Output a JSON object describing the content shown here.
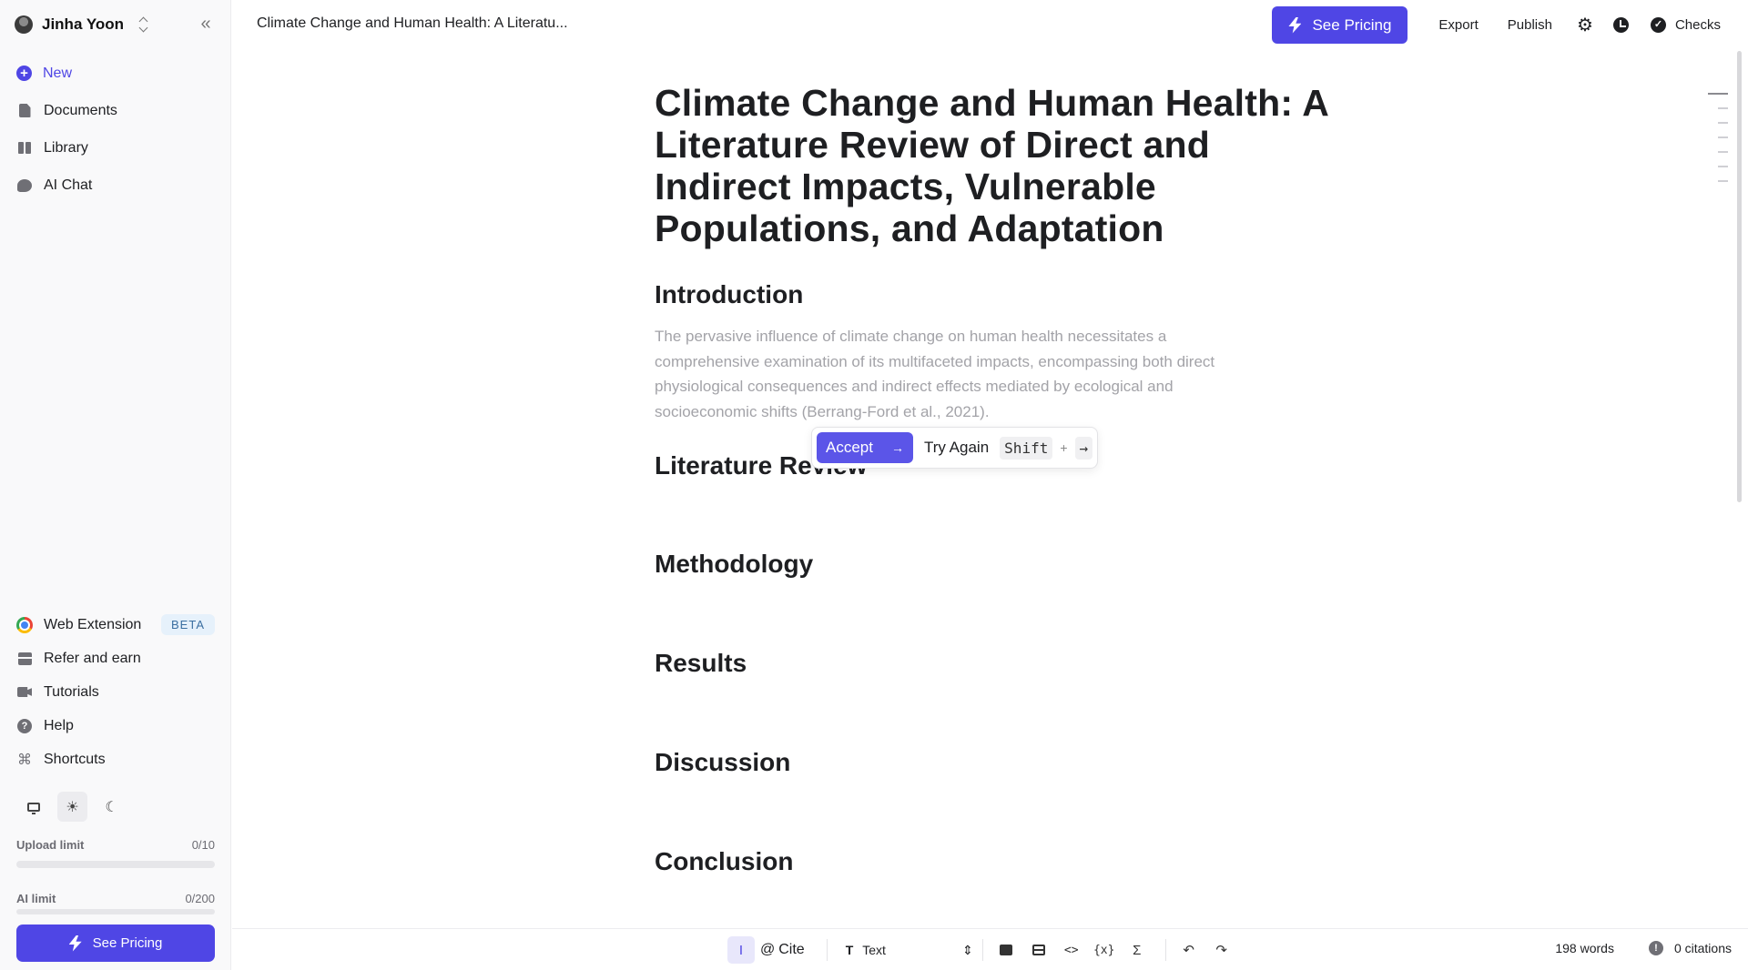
{
  "sidebar": {
    "user_name": "Jinha Yoon",
    "collapse_glyph": "«",
    "nav": [
      {
        "label": "New",
        "icon": "plus-circle-icon"
      },
      {
        "label": "Documents",
        "icon": "document-icon"
      },
      {
        "label": "Library",
        "icon": "library-icon"
      },
      {
        "label": "AI Chat",
        "icon": "chat-icon"
      }
    ],
    "bottom_nav": [
      {
        "label": "Web Extension",
        "badge": "BETA",
        "icon": "chrome-icon"
      },
      {
        "label": "Refer and earn",
        "icon": "gift-icon"
      },
      {
        "label": "Tutorials",
        "icon": "video-camera-icon"
      },
      {
        "label": "Help",
        "icon": "help-circle-icon"
      },
      {
        "label": "Shortcuts",
        "icon": "command-icon"
      }
    ],
    "theme_selected": "light",
    "upload_limit": {
      "label": "Upload limit",
      "value": "0/10",
      "fraction": 0
    },
    "ai_limit": {
      "label": "AI limit",
      "value": "0/200",
      "fraction": 0
    },
    "pricing_label": "See Pricing"
  },
  "topbar": {
    "doc_title": "Climate Change and Human Health: A Literatu...",
    "pricing_label": "See Pricing",
    "export_label": "Export",
    "publish_label": "Publish",
    "checks_label": "Checks"
  },
  "document": {
    "title": "Climate Change and Human Health: A Literature Review of Direct and Indirect Impacts, Vulnerable Populations, and Adaptation",
    "sections": {
      "introduction": "Introduction",
      "literature_review": "Literature Review",
      "methodology": "Methodology",
      "results": "Results",
      "discussion": "Discussion",
      "conclusion": "Conclusion"
    },
    "intro_suggestion": "The pervasive influence of climate change on human health necessitates a comprehensive examination of its multifaceted impacts, encompassing both direct physiological consequences and indirect effects mediated by ecological and socioeconomic shifts (Berrang-Ford et al., 2021)."
  },
  "suggestion_popup": {
    "accept_label": "Accept",
    "accept_key": "→",
    "retry_label": "Try Again",
    "shift_key": "Shift",
    "plus": "+",
    "retry_key": "→"
  },
  "toolbar": {
    "cite_label": "Cite",
    "text_style": "Text",
    "word_count": "198 words",
    "citations": "0 citations"
  },
  "colors": {
    "accent": "#4f46e5",
    "muted_text": "#a3a3a8"
  }
}
